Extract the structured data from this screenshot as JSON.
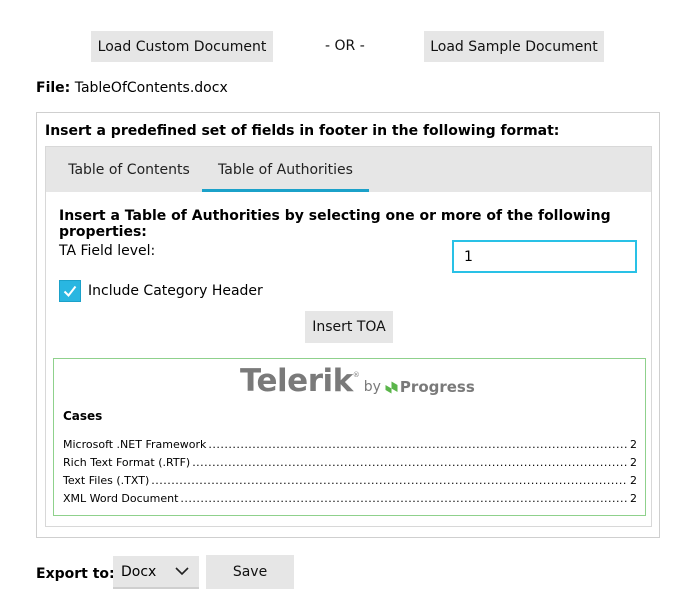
{
  "top": {
    "load_custom": "Load Custom Document",
    "or": "- OR -",
    "load_sample": "Load Sample Document"
  },
  "file": {
    "label": "File:",
    "name": "TableOfContents.docx"
  },
  "panel": {
    "title": "Insert a predefined set of fields in footer in the following format:",
    "tabs": [
      {
        "label": "Table of Contents",
        "selected": false
      },
      {
        "label": "Table of Authorities",
        "selected": true
      }
    ]
  },
  "toa": {
    "heading": "Insert a Table of Authorities by selecting one or more of the following properties:",
    "field_level_label": "TA Field level:",
    "field_level_value": "1",
    "include_category_label": "Include Category Header",
    "include_category_checked": true,
    "insert_button": "Insert TOA"
  },
  "preview": {
    "logo_main": "Telerik",
    "logo_by": "by",
    "logo_progress": "Progress",
    "cases_title": "Cases",
    "entries": [
      {
        "name": "Microsoft .NET Framework",
        "page": "2"
      },
      {
        "name": "Rich Text Format (.RTF)",
        "page": "2"
      },
      {
        "name": "Text Files (.TXT)",
        "page": "2"
      },
      {
        "name": "XML Word Document",
        "page": "2"
      }
    ]
  },
  "export": {
    "label": "Export to:",
    "format": "Docx",
    "save": "Save"
  },
  "colors": {
    "accent": "#1ba1c9",
    "preview_border": "#8fd18c",
    "logo_green": "#5ab54a"
  }
}
